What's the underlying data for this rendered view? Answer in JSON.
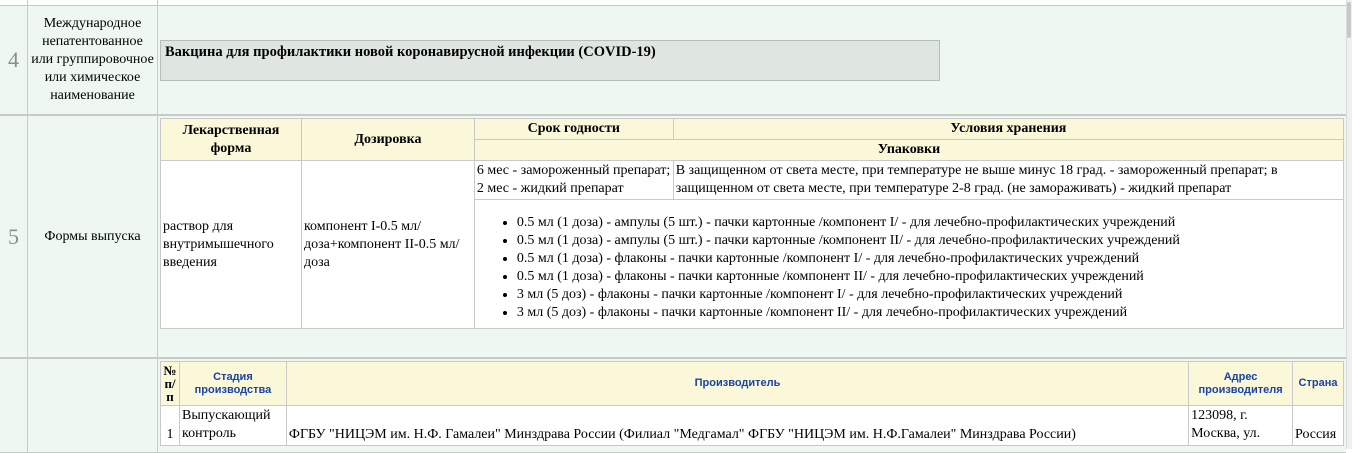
{
  "row4": {
    "number": "4",
    "label": "Международное непатентованное или группировочное или химическое наименование",
    "value": "Вакцина для профилактики новой коронавирусной инфекции (COVID-19)"
  },
  "row5": {
    "number": "5",
    "label": "Формы выпуска",
    "headers": {
      "form": "Лекарственная форма",
      "dosage": "Дозировка",
      "shelf_life": "Срок годности",
      "storage": "Условия хранения",
      "packaging": "Упаковки"
    },
    "form": "раствор для внутримышечного введения",
    "dosage": "компонент I-0.5 мл/доза+компонент II-0.5 мл/доза",
    "shelf_life": "6 мес - замороженный препарат; 2 мес - жидкий препарат",
    "storage": "В защищенном от света месте, при температуре не выше минус 18 град. - замороженный препарат; в защищенном от света месте, при температуре 2-8 град. (не замораживать) - жидкий препарат",
    "packages": [
      "0.5 мл (1 доза) - ампулы (5 шт.) - пачки картонные /компонент I/ - для лечебно-профилактических учреждений",
      "0.5 мл (1 доза) - ампулы (5 шт.) - пачки картонные /компонент II/ - для лечебно-профилактических учреждений",
      "0.5 мл (1 доза) - флаконы - пачки картонные /компонент I/ - для лечебно-профилактических учреждений",
      "0.5 мл (1 доза) - флаконы - пачки картонные /компонент II/ - для лечебно-профилактических учреждений",
      "3 мл (5 доз) - флаконы - пачки картонные /компонент I/ - для лечебно-профилактических учреждений",
      "3 мл (5 доз) - флаконы - пачки картонные /компонент II/ - для лечебно-профилактических учреждений"
    ]
  },
  "row6": {
    "headers": {
      "num": "№ п/п",
      "stage": "Стадия производства",
      "manufacturer": "Производитель",
      "address": "Адрес производителя",
      "country": "Страна"
    },
    "rows": [
      {
        "num": "1",
        "stage": "Выпускающий контроль",
        "manufacturer": "ФГБУ \"НИЦЭМ им. Н.Ф. Гамалеи\" Минздрава России (Филиал \"Медгамал\" ФГБУ \"НИЦЭМ им. Н.Ф.Гамалеи\" Минздрава России)",
        "address": "123098, г. Москва, ул.",
        "country": "Россия"
      }
    ]
  }
}
